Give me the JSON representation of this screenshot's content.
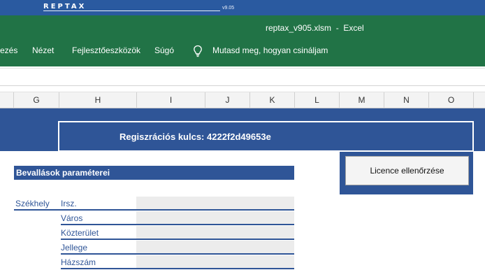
{
  "brand": {
    "name": "REPTAX",
    "version": "v9.05",
    "bar_color": "#2a5aa0"
  },
  "window": {
    "title": "reptax_v905.xlsm  -  Excel",
    "ribbon_color": "#217346"
  },
  "menu": {
    "items": [
      {
        "label": "ezés"
      },
      {
        "label": "Nézet"
      },
      {
        "label": "Fejlesztőeszközök"
      },
      {
        "label": "Súgó"
      }
    ],
    "tell_me_icon": "lightbulb-icon",
    "tell_me": "Mutasd meg, hogyan csináljam"
  },
  "columns": [
    "G",
    "H",
    "I",
    "J",
    "K",
    "L",
    "M",
    "N",
    "O"
  ],
  "registration": {
    "label": "Regiszrációs kulcs: 4222f2d49653e"
  },
  "licence_button": {
    "label": "Licence ellenőrzése"
  },
  "section": {
    "title": "Bevallások paraméterei",
    "accent_color": "#2f5597",
    "group_label": "Székhely",
    "fields": [
      {
        "label": "Irsz.",
        "value": ""
      },
      {
        "label": "Város",
        "value": ""
      },
      {
        "label": "Közterület",
        "value": ""
      },
      {
        "label": "Jellege",
        "value": ""
      },
      {
        "label": "Házszám",
        "value": ""
      }
    ]
  }
}
